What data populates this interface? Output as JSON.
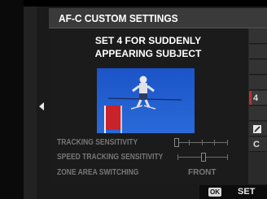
{
  "header": {
    "title": "AF-C CUSTOM SETTINGS"
  },
  "preset": {
    "line1": "SET 4 FOR SUDDENLY",
    "line2": "APPEARING SUBJECT",
    "illustration": "skier-jumping-past-red-gate"
  },
  "settings": [
    {
      "label": "TRACKING SENSITIVITY",
      "control": "slider",
      "level": 0,
      "steps": 5
    },
    {
      "label": "SPEED TRACKING SENSITIVITY",
      "control": "slider",
      "level": 1,
      "steps": 3
    },
    {
      "label": "ZONE AREA SWITCHING",
      "value": "FRONT"
    }
  ],
  "side_menu": {
    "items": [
      {
        "label": "",
        "active": false
      },
      {
        "label": "",
        "active": false
      },
      {
        "label": "",
        "active": false
      },
      {
        "label": "",
        "active": false
      },
      {
        "label": "4",
        "active": true
      },
      {
        "label": "",
        "active": false
      },
      {
        "label": "",
        "icon": "wrench-icon",
        "active": false
      },
      {
        "label": "C",
        "active": false
      }
    ]
  },
  "footer": {
    "ok_label": "OK",
    "set_label": "SET"
  },
  "colors": {
    "accent": "#c93a3a",
    "panel": "#1b1b1b",
    "title_bar": "#3a3a3a",
    "dim_text": "#777777"
  }
}
